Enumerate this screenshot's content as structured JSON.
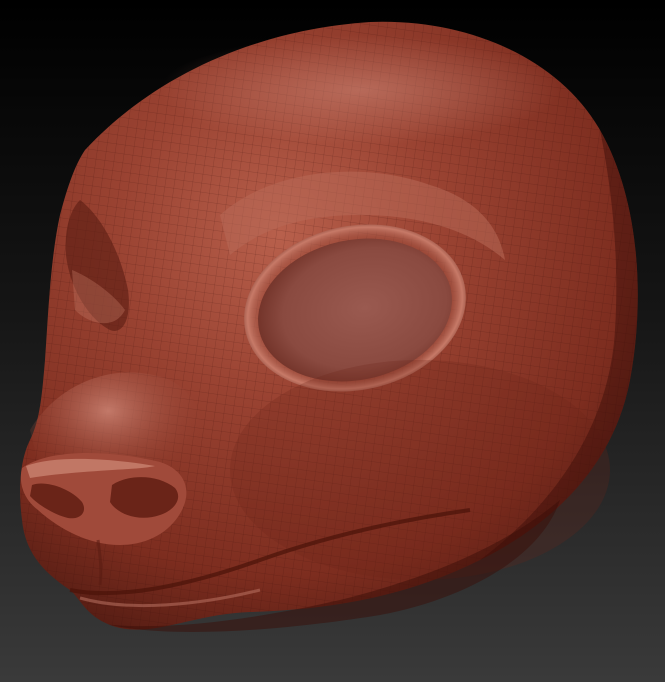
{
  "scene": {
    "subject_icon": "sculpted-head-icon",
    "colors": {
      "background_top": "#000000",
      "background_bottom": "#3a3a3a",
      "material_base": "#8e3a2a",
      "material_highlight": "#c27a6a",
      "material_shadow": "#4a1810"
    }
  }
}
